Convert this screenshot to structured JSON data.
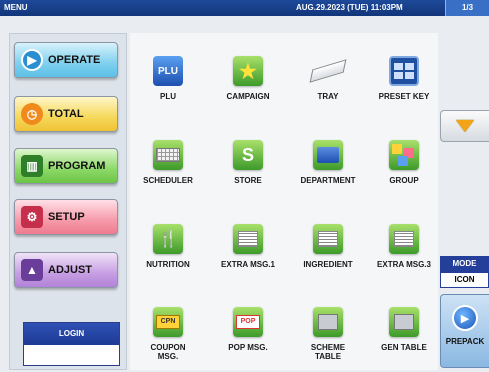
{
  "titlebar": {
    "title": "MENU",
    "datetime": "AUG.29.2023 (TUE) 11:03PM",
    "page": "1/3"
  },
  "nav": {
    "operate": "OPERATE",
    "total": "TOTAL",
    "program": "PROGRAM",
    "setup": "SETUP",
    "adjust": "ADJUST"
  },
  "login": {
    "label": "LOGIN",
    "value": ""
  },
  "tiles": [
    {
      "label": "PLU",
      "icon": "plu-icon"
    },
    {
      "label": "CAMPAIGN",
      "icon": "star-icon"
    },
    {
      "label": "TRAY",
      "icon": "tray-icon"
    },
    {
      "label": "PRESET KEY",
      "icon": "preset-key-icon"
    },
    {
      "label": "SCHEDULER",
      "icon": "keyboard-icon"
    },
    {
      "label": "STORE",
      "icon": "store-icon"
    },
    {
      "label": "DEPARTMENT",
      "icon": "folder-icon"
    },
    {
      "label": "GROUP",
      "icon": "group-icon"
    },
    {
      "label": "NUTRITION",
      "icon": "utensils-icon"
    },
    {
      "label": "EXTRA MSG.1",
      "icon": "message-icon"
    },
    {
      "label": "INGREDIENT",
      "icon": "message-icon"
    },
    {
      "label": "EXTRA MSG.3",
      "icon": "message-icon"
    },
    {
      "label": "COUPON\nMSG.",
      "icon": "coupon-icon"
    },
    {
      "label": "POP MSG.",
      "icon": "pop-icon"
    },
    {
      "label": "SCHEME\nTABLE",
      "icon": "scheme-table-icon"
    },
    {
      "label": "GEN TABLE",
      "icon": "gen-table-icon"
    }
  ],
  "tile_text": {
    "plu": "PLU",
    "cpn": "CPN",
    "pop": "POP"
  },
  "mode": {
    "label": "MODE",
    "value": "ICON"
  },
  "prepack": {
    "label": "PREPACK"
  },
  "colors": {
    "titlebar": "#1e4a9a",
    "accent_green": "#3d9a2a",
    "arrow": "#f3a316"
  }
}
